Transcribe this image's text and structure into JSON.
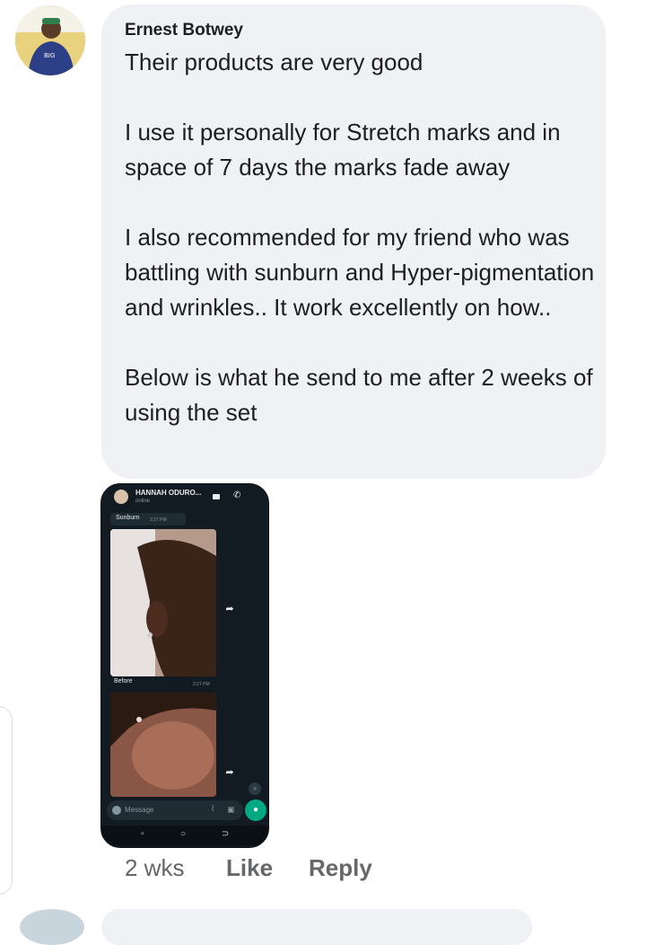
{
  "comment": {
    "author": "Ernest Botwey",
    "text": "Their products are very good\n\nI use it personally for Stretch marks and in space of 7 days the marks fade away\n\nI also recommended for my friend who was battling with sunburn and Hyper-pigmentation and wrinkles.. It work excellently on how..\n\nBelow is what he send to me after 2 weeks of using the set",
    "timestamp": "2 wks",
    "like_label": "Like",
    "reply_label": "Reply"
  },
  "attachment": {
    "chat_name": "HANNAH ODURO...",
    "chat_status": "online",
    "message_text": "Sunburn",
    "message_time": "2:27 PM",
    "image_caption": "Before",
    "image_caption_time": "2:27 PM",
    "input_placeholder": "Message"
  },
  "colors": {
    "bubble_bg": "#f0f1f4",
    "secondary_text": "#65676b",
    "whatsapp_green": "#00a884",
    "chat_bg": "#121b22"
  },
  "icons": [
    "video-call-icon",
    "phone-call-icon",
    "forward-icon",
    "scroll-down-icon",
    "emoji-icon",
    "attach-icon",
    "camera-icon",
    "mic-icon"
  ]
}
